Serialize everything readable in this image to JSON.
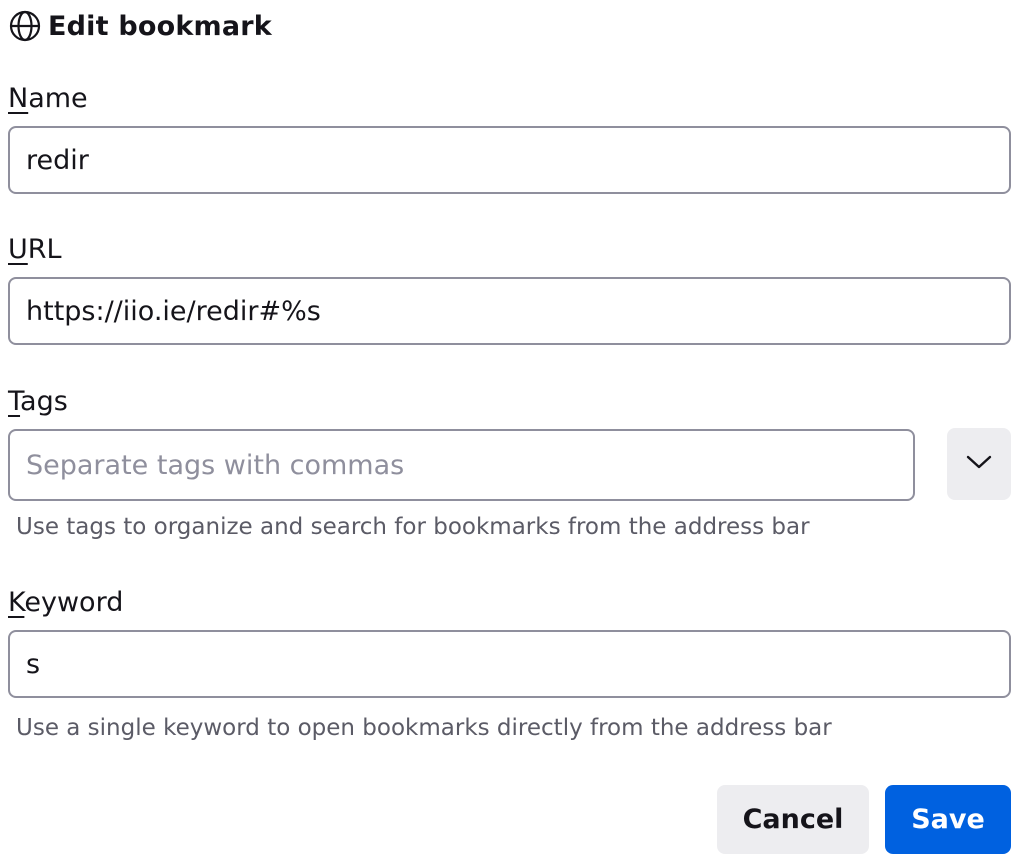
{
  "dialog": {
    "title": "Edit bookmark",
    "title_icon": "globe-icon"
  },
  "name": {
    "label_access": "N",
    "label_rest": "ame",
    "value": "redir"
  },
  "url": {
    "label_access": "U",
    "label_rest": "RL",
    "value": "https://iio.ie/redir#%s"
  },
  "tags": {
    "label_access": "T",
    "label_rest": "ags",
    "value": "",
    "placeholder": "Separate tags with commas",
    "toggle_icon": "chevron-down-icon",
    "help": "Use tags to organize and search for bookmarks from the address bar"
  },
  "keyword": {
    "label_access": "K",
    "label_rest": "eyword",
    "value": "s",
    "help": "Use a single keyword to open bookmarks directly from the address bar"
  },
  "buttons": {
    "cancel": "Cancel",
    "save": "Save"
  },
  "colors": {
    "accent": "#0061e0",
    "neutral_button": "#ededf0",
    "border": "#8f8f9d",
    "help_text": "#5b5b66"
  }
}
